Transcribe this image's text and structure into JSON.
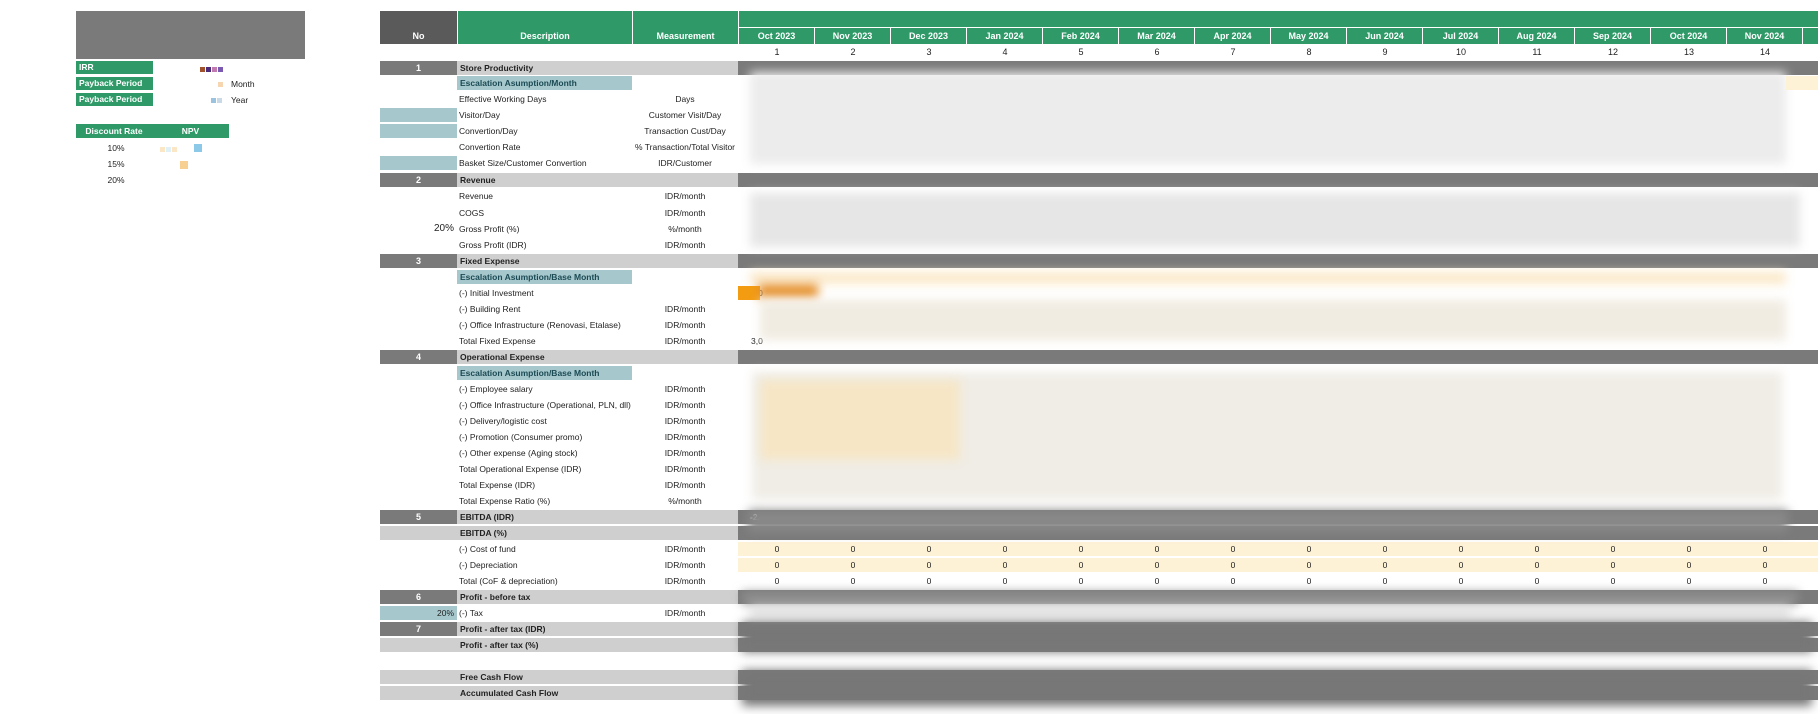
{
  "left_panel": {
    "irr_label": "IRR",
    "payback_label_1": "Payback Period",
    "payback_unit_1": "Month",
    "payback_label_2": "Payback Period",
    "payback_unit_2": "Year",
    "npv_table": {
      "headers": [
        "Discount Rate",
        "NPV"
      ],
      "rates": [
        "10%",
        "15%",
        "20%"
      ]
    }
  },
  "table": {
    "headers": {
      "no": "No",
      "description": "Description",
      "measurement": "Measurement"
    },
    "months": [
      "Oct 2023",
      "Nov 2023",
      "Dec 2023",
      "Jan 2024",
      "Feb 2024",
      "Mar 2024",
      "Apr 2024",
      "May 2024",
      "Jun 2024",
      "Jul 2024",
      "Aug 2024",
      "Sep 2024",
      "Oct 2024",
      "Nov 2024"
    ],
    "month_numbers": [
      "1",
      "2",
      "3",
      "4",
      "5",
      "6",
      "7",
      "8",
      "9",
      "10",
      "11",
      "12",
      "13",
      "14"
    ],
    "pct_gross": "20%",
    "pct_tax": "20%",
    "rows": {
      "s1": {
        "no": "1",
        "desc": "Store Productivity"
      },
      "r1a": {
        "desc": "Escalation Asumption/Month"
      },
      "r1b": {
        "desc": "Effective Working Days",
        "meas": "Days"
      },
      "r1c": {
        "desc": "Visitor/Day",
        "meas": "Customer Visit/Day"
      },
      "r1d": {
        "desc": "Convertion/Day",
        "meas": "Transaction Cust/Day"
      },
      "r1e": {
        "desc": "Convertion Rate",
        "meas": "% Transaction/Total Visitor"
      },
      "r1f": {
        "desc": "Basket Size/Customer Convertion",
        "meas": "IDR/Customer"
      },
      "s2": {
        "no": "2",
        "desc": "Revenue"
      },
      "r2a": {
        "desc": "Revenue",
        "meas": "IDR/month"
      },
      "r2b": {
        "desc": "COGS",
        "meas": "IDR/month"
      },
      "r2c": {
        "desc": "Gross Profit (%)",
        "meas": "%/month"
      },
      "r2d": {
        "desc": "Gross Profit (IDR)",
        "meas": "IDR/month"
      },
      "s3": {
        "no": "3",
        "desc": "Fixed Expense"
      },
      "r3a": {
        "desc": "Escalation Asumption/Base Month"
      },
      "r3b": {
        "desc": "(-) Initial Investment",
        "val": "3,0"
      },
      "r3c": {
        "desc": "(-) Building Rent",
        "meas": "IDR/month"
      },
      "r3d": {
        "desc": "(-) Office Infrastructure (Renovasi, Etalase)",
        "meas": "IDR/month"
      },
      "r3e": {
        "desc": "Total Fixed Expense",
        "meas": "IDR/month",
        "val": "3,0"
      },
      "s4": {
        "no": "4",
        "desc": "Operational Expense"
      },
      "r4a": {
        "desc": "Escalation Asumption/Base Month"
      },
      "r4b": {
        "desc": "(-) Employee salary",
        "meas": "IDR/month"
      },
      "r4c": {
        "desc": "(-) Office Infrastructure (Operational, PLN, dll)",
        "meas": "IDR/month"
      },
      "r4d": {
        "desc": "(-) Delivery/logistic cost",
        "meas": "IDR/month"
      },
      "r4e": {
        "desc": "(-) Promotion (Consumer promo)",
        "meas": "IDR/month"
      },
      "r4f": {
        "desc": "(-) Other expense (Aging stock)",
        "meas": "IDR/month"
      },
      "r4g": {
        "desc": "Total Operational Expense (IDR)",
        "meas": "IDR/month"
      },
      "r4h": {
        "desc": "Total Expense (IDR)",
        "meas": "IDR/month"
      },
      "r4i": {
        "desc": "Total Expense Ratio (%)",
        "meas": "%/month"
      },
      "s5": {
        "no": "5",
        "desc": "EBITDA (IDR)",
        "val": "-2,"
      },
      "r5a": {
        "desc": "EBITDA (%)"
      },
      "r5b": {
        "desc": "(-) Cost of fund",
        "meas": "IDR/month"
      },
      "r5c": {
        "desc": "(-) Depreciation",
        "meas": "IDR/month"
      },
      "r5d": {
        "desc": "Total (CoF & depreciation)",
        "meas": "IDR/month"
      },
      "s6": {
        "no": "6",
        "desc": "Profit - before tax"
      },
      "r6a": {
        "desc": "(-) Tax",
        "meas": "IDR/month"
      },
      "s7": {
        "no": "7",
        "desc": "Profit - after tax (IDR)"
      },
      "r7a": {
        "desc": "Profit - after tax (%)"
      },
      "r8a": {
        "desc": "Free Cash Flow"
      },
      "r8b": {
        "desc": "Accumulated Cash Flow"
      }
    },
    "zero_value": "0"
  },
  "colors": {
    "green": "#2f9a68",
    "dark_gray": "#7a7a7a",
    "light_gray": "#cfcfcf",
    "teal": "#a6c7cc",
    "cream": "#fdf1d6",
    "orange": "#f39c12"
  }
}
